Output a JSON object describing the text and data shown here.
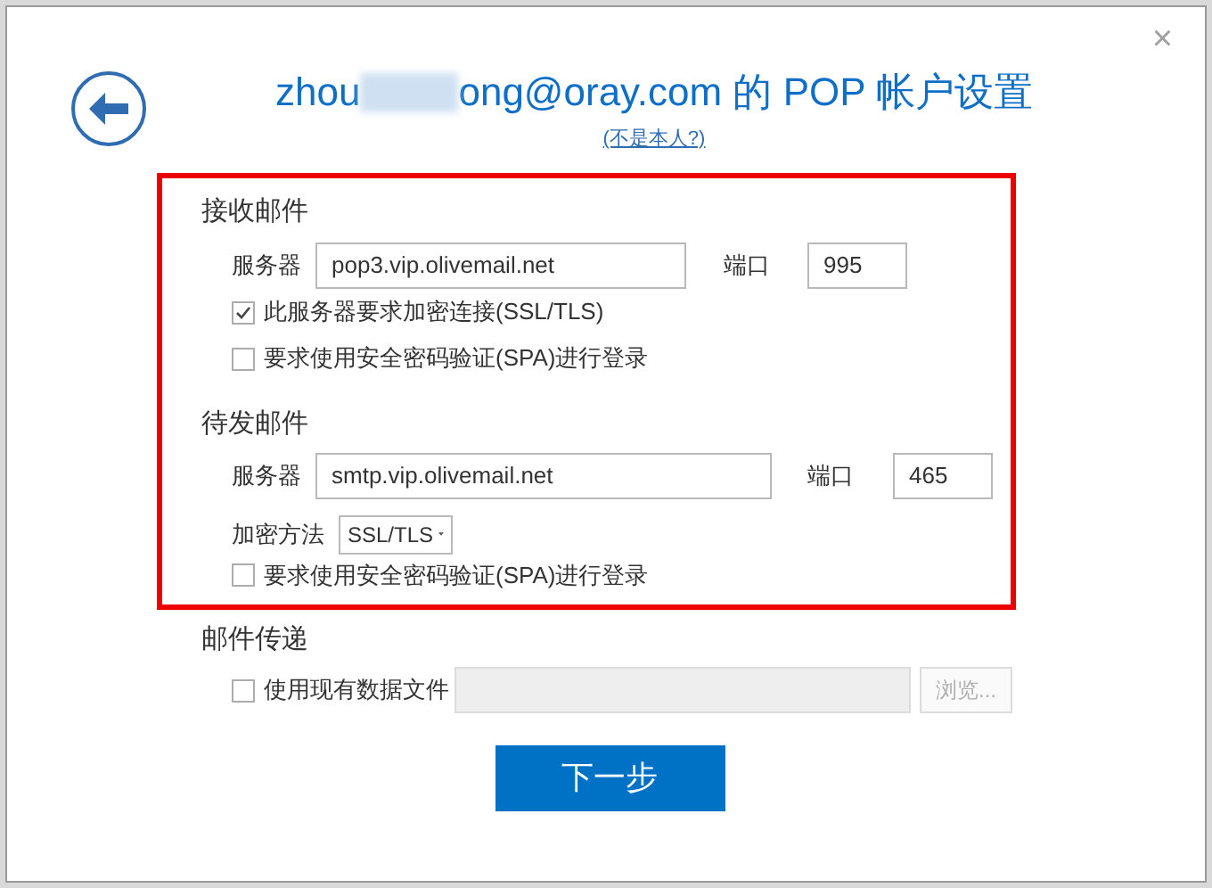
{
  "window": {
    "close": "×"
  },
  "header": {
    "title_start": "zhou",
    "title_redacted": true,
    "title_end": "ong@oray.com 的 POP 帐户设置",
    "link": "(不是本人?)"
  },
  "incoming": {
    "heading": "接收邮件",
    "server_label": "服务器",
    "server": "pop3.vip.olivemail.net",
    "port_label": "端口",
    "port": "995",
    "options": [
      {
        "label": "此服务器要求加密连接(SSL/TLS)",
        "checked": true
      },
      {
        "label": "要求使用安全密码验证(SPA)进行登录",
        "checked": false
      }
    ]
  },
  "outgoing": {
    "heading": "待发邮件",
    "server_label": "服务器",
    "server": "smtp.vip.olivemail.net",
    "port_label": "端口",
    "port": "465",
    "encryption_label": "加密方法",
    "encryption": "SSL/TLS",
    "options": [
      {
        "label": "要求使用安全密码验证(SPA)进行登录",
        "checked": false
      }
    ]
  },
  "delivery": {
    "heading": "邮件传递",
    "option": {
      "label": "使用现有数据文件",
      "checked": false
    },
    "file_disabled": true,
    "browse": "浏览...",
    "browse_disabled": true
  },
  "next_button": "下一步"
}
